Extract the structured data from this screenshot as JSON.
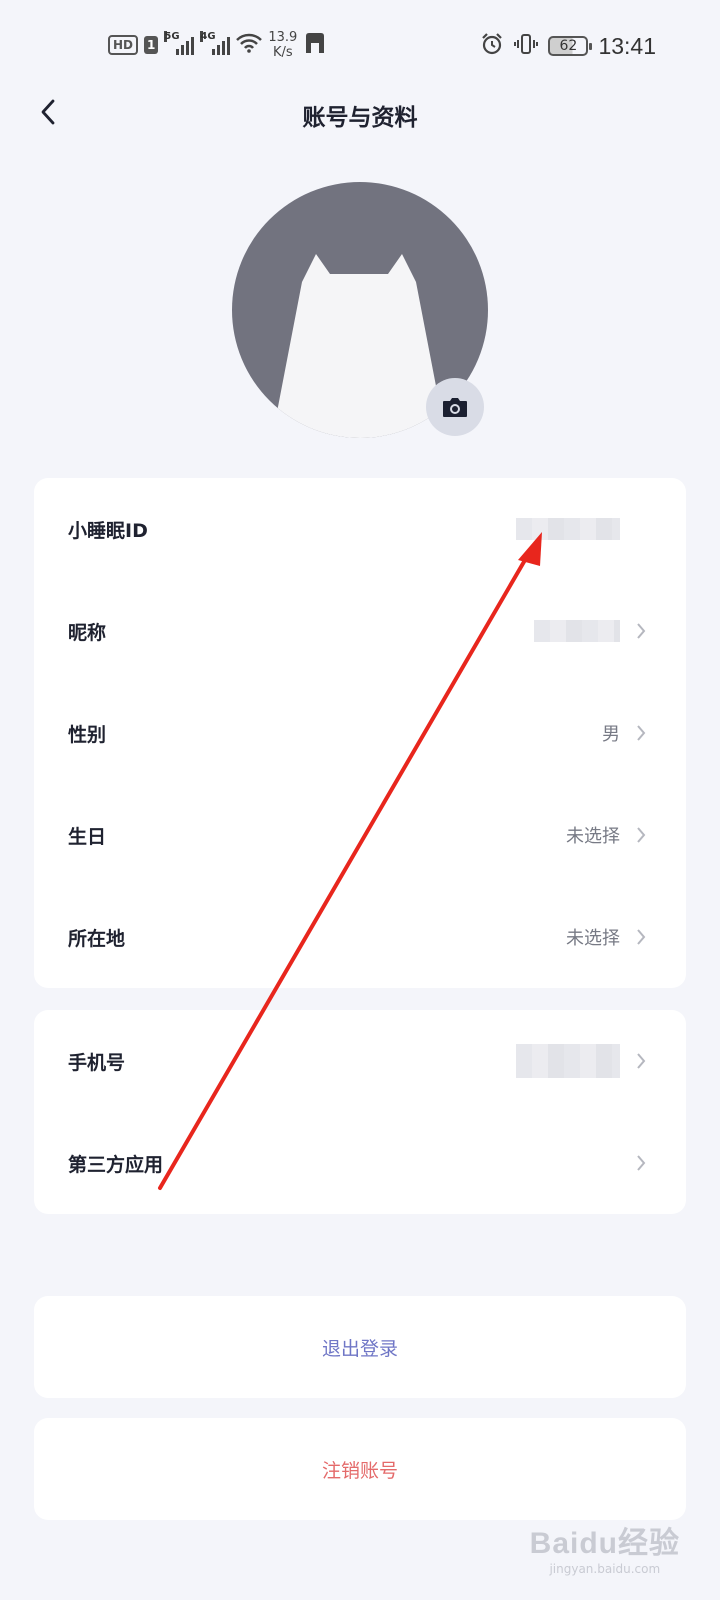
{
  "status_bar": {
    "hd_label": "HD",
    "sim_label": "1",
    "net1": "5G",
    "net2": "4G",
    "speed_value": "13.9",
    "speed_unit": "K/s",
    "battery": "62",
    "time": "13:41"
  },
  "header": {
    "title": "账号与资料"
  },
  "profile": {
    "rows": [
      {
        "label": "小睡眠ID",
        "value": ""
      },
      {
        "label": "昵称",
        "value": ""
      },
      {
        "label": "性别",
        "value": "男"
      },
      {
        "label": "生日",
        "value": "未选择"
      },
      {
        "label": "所在地",
        "value": "未选择"
      }
    ]
  },
  "account": {
    "rows": [
      {
        "label": "手机号",
        "value": ""
      },
      {
        "label": "第三方应用",
        "value": ""
      }
    ]
  },
  "actions": {
    "logout": "退出登录",
    "delete_account": "注销账号"
  },
  "colors": {
    "background": "#f4f5fa",
    "logout": "#6f76c6",
    "delete": "#e46a6a",
    "annotation_arrow": "#e8261d"
  },
  "watermark": {
    "logo": "Baidu经验",
    "sub": "jingyan.baidu.com"
  }
}
